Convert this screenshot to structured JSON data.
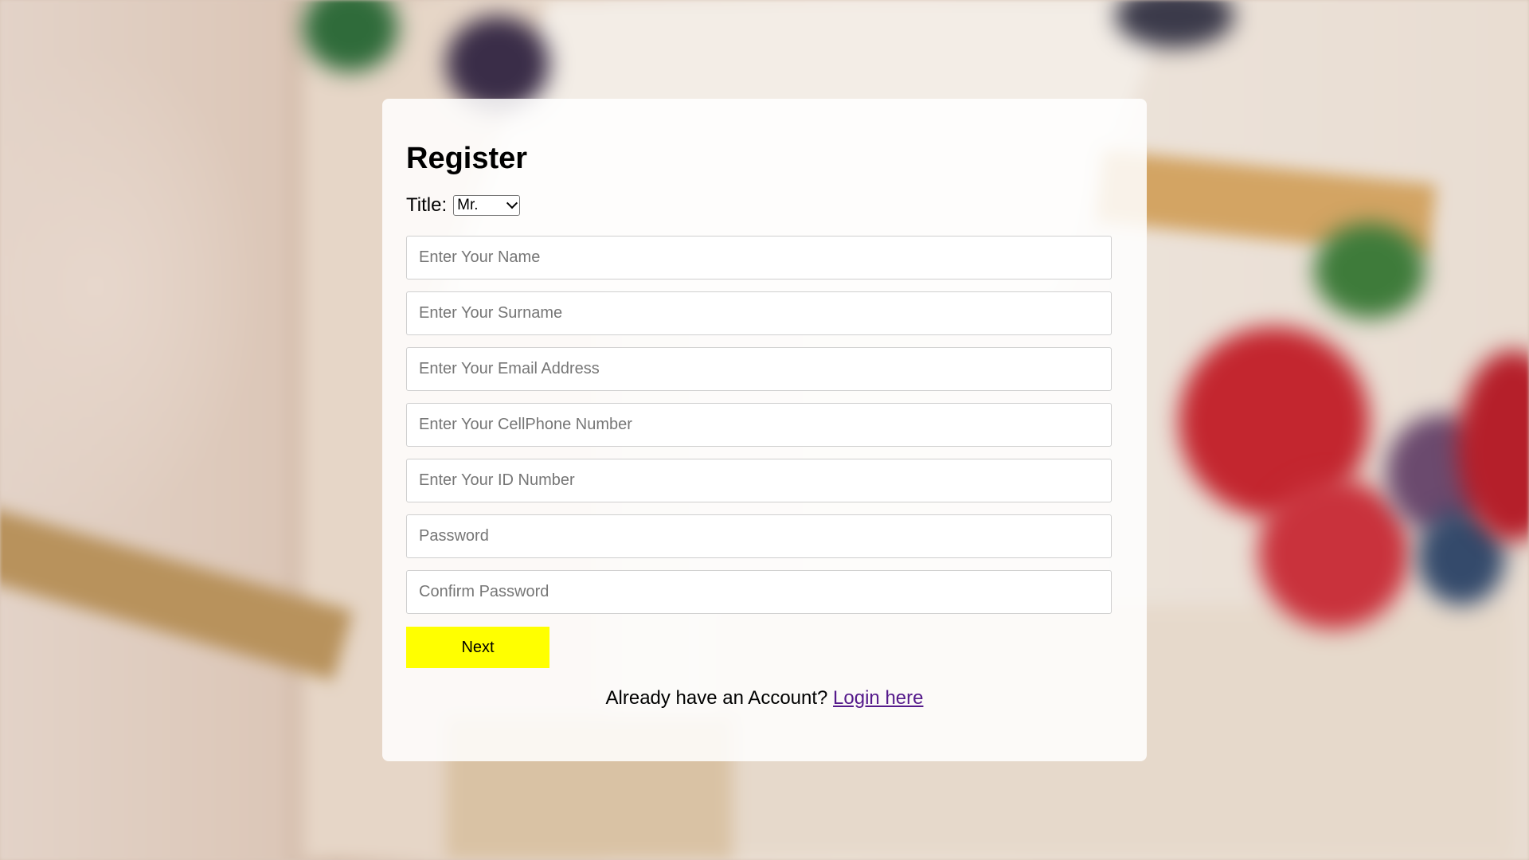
{
  "form": {
    "heading": "Register",
    "title_label": "Title:",
    "title_selected": "Mr.",
    "fields": [
      {
        "name": "name-input",
        "placeholder": "Enter Your Name",
        "type": "text"
      },
      {
        "name": "surname-input",
        "placeholder": "Enter Your Surname",
        "type": "text"
      },
      {
        "name": "email-input",
        "placeholder": "Enter Your Email Address",
        "type": "email"
      },
      {
        "name": "cellphone-input",
        "placeholder": "Enter Your CellPhone Number",
        "type": "tel"
      },
      {
        "name": "id-number-input",
        "placeholder": "Enter Your ID Number",
        "type": "text"
      },
      {
        "name": "password-input",
        "placeholder": "Password",
        "type": "password"
      },
      {
        "name": "confirm-password-input",
        "placeholder": "Confirm Password",
        "type": "password"
      }
    ],
    "next_label": "Next",
    "login_prompt": "Already have an Account?",
    "login_link": "Login here"
  },
  "colors": {
    "next_button": "#ffff00",
    "link": "#551a8b"
  }
}
